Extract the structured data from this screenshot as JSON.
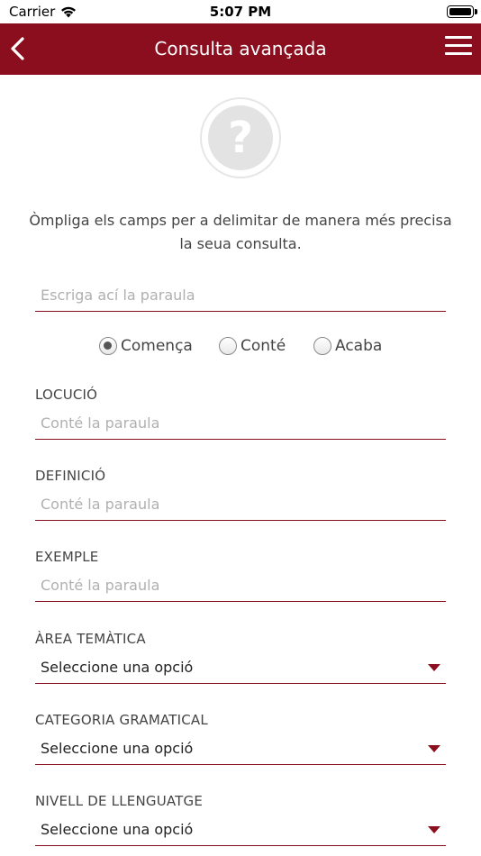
{
  "status_bar": {
    "carrier": "Carrier",
    "time": "5:07 PM"
  },
  "nav": {
    "title": "Consulta avançada",
    "back_icon": "chevron-left-icon",
    "menu_icon": "hamburger-menu-icon"
  },
  "help_icon": "question-mark-icon",
  "intro_text": "Òmpliga els camps per a delimitar de manera més precisa la seua consulta.",
  "search": {
    "placeholder": "Escriga ací la paraula",
    "value": ""
  },
  "match_options": [
    {
      "label": "Comença",
      "selected": true
    },
    {
      "label": "Conté",
      "selected": false
    },
    {
      "label": "Acaba",
      "selected": false
    }
  ],
  "fields": {
    "locucio": {
      "label": "LOCUCIÓ",
      "placeholder": "Conté la paraula",
      "value": ""
    },
    "definicio": {
      "label": "DEFINICIÓ",
      "placeholder": "Conté la paraula",
      "value": ""
    },
    "exemple": {
      "label": "EXEMPLE",
      "placeholder": "Conté la paraula",
      "value": ""
    }
  },
  "selects": {
    "area": {
      "label": "ÀREA TEMÀTICA",
      "value": "Seleccione una opció"
    },
    "categoria": {
      "label": "CATEGORIA GRAMATICAL",
      "value": "Seleccione una opció"
    },
    "nivell": {
      "label": "NIVELL DE LLENGUATGE",
      "value": "Seleccione una opció"
    }
  },
  "colors": {
    "accent": "#8b0e1e",
    "placeholder": "#b0b0b0"
  }
}
